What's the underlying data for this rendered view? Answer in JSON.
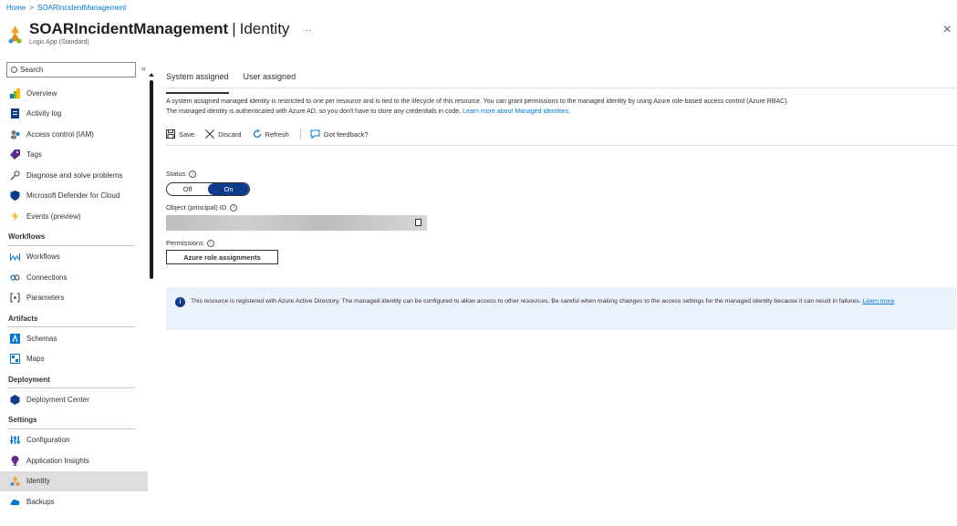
{
  "breadcrumb": {
    "home": "Home",
    "separator": ">",
    "current": "SOARIncidentManagement"
  },
  "header": {
    "resource_name": "SOARIncidentManagement",
    "separator": "|",
    "page": "Identity",
    "more": "···",
    "subtitle": "Logic App (Standard)",
    "close": "×"
  },
  "sidebar": {
    "search_label": "Search",
    "collapse": "«",
    "items": [
      {
        "type": "item",
        "label": "Overview",
        "icon": "overview-icon"
      },
      {
        "type": "item",
        "label": "Activity log",
        "icon": "activity-log-icon"
      },
      {
        "type": "item",
        "label": "Access control (IAM)",
        "icon": "iam-icon"
      },
      {
        "type": "item",
        "label": "Tags",
        "icon": "tag-icon"
      },
      {
        "type": "item",
        "label": "Diagnose and solve problems",
        "icon": "wrench-icon"
      },
      {
        "type": "item",
        "label": "Microsoft Defender for Cloud",
        "icon": "shield-icon"
      },
      {
        "type": "item",
        "label": "Events (preview)",
        "icon": "lightning-icon"
      },
      {
        "type": "section",
        "label": "Workflows"
      },
      {
        "type": "item",
        "label": "Workflows",
        "icon": "workflow-icon"
      },
      {
        "type": "item",
        "label": "Connections",
        "icon": "connections-icon"
      },
      {
        "type": "item",
        "label": "Parameters",
        "icon": "parameters-icon"
      },
      {
        "type": "section",
        "label": "Artifacts"
      },
      {
        "type": "item",
        "label": "Schemas",
        "icon": "schema-icon"
      },
      {
        "type": "item",
        "label": "Maps",
        "icon": "maps-icon"
      },
      {
        "type": "section",
        "label": "Deployment"
      },
      {
        "type": "item",
        "label": "Deployment Center",
        "icon": "deployment-center-icon"
      },
      {
        "type": "section",
        "label": "Settings"
      },
      {
        "type": "item",
        "label": "Configuration",
        "icon": "configuration-icon"
      },
      {
        "type": "item",
        "label": "Application Insights",
        "icon": "app-insights-icon"
      },
      {
        "type": "item",
        "label": "Identity",
        "icon": "identity-icon",
        "active": true
      },
      {
        "type": "item",
        "label": "Backups",
        "icon": "backups-icon"
      }
    ]
  },
  "tabs": [
    {
      "label": "System assigned",
      "active": true
    },
    {
      "label": "User assigned",
      "active": false
    }
  ],
  "description": {
    "line1": "A system assigned managed identity is restricted to one per resource and is tied to the lifecycle of this resource. You can grant permissions to the managed identity by using Azure role-based access control (Azure RBAC).",
    "line2": "The managed identity is authenticated with Azure AD, so you don't have to store any credentials in code.",
    "link": "Learn more about Managed identities."
  },
  "toolbar": {
    "save": "Save",
    "discard": "Discard",
    "refresh": "Refresh",
    "feedback": "Got feedback?"
  },
  "status": {
    "label": "Status",
    "off": "Off",
    "on": "On",
    "value": "On"
  },
  "object_id": {
    "label": "Object (principal) ID"
  },
  "permissions": {
    "label": "Permissions",
    "button": "Azure role assignments"
  },
  "banner": {
    "icon": "i",
    "text": "This resource is registered with Azure Active Directory. The managed identity can be configured to allow access to other resources. Be careful when making changes to the access settings for the managed identity because it can result in failures.",
    "link": "Learn more"
  },
  "colors": {
    "accent": "#0078d4",
    "toggle_on": "#0f3b8c",
    "banner_bg": "#ebf1fb"
  }
}
